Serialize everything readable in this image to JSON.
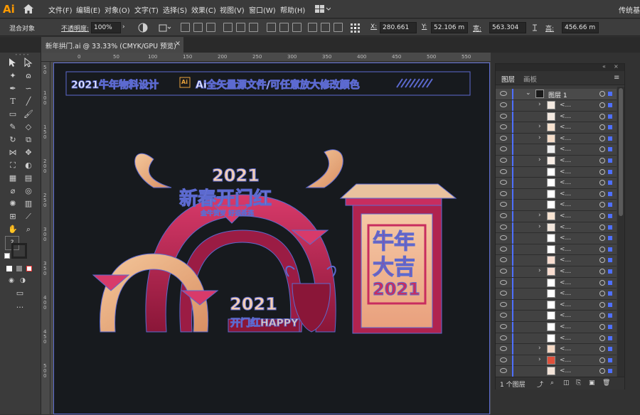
{
  "app": {
    "logo": "Ai",
    "workspace": "传统基"
  },
  "menu": [
    "文件(F)",
    "编辑(E)",
    "对象(O)",
    "文字(T)",
    "选择(S)",
    "效果(C)",
    "视图(V)",
    "窗口(W)",
    "帮助(H)"
  ],
  "control": {
    "object_type": "混合对象",
    "opacity_label": "不透明度:",
    "opacity_value": "100%",
    "x_label": "X:",
    "x_value": "280.661",
    "y_label": "Y:",
    "y_value": "52.106 m",
    "w_label": "宽:",
    "w_value": "563.304",
    "h_label": "高:",
    "h_value": "456.66 m"
  },
  "document_tab": {
    "title": "新年拱门.ai @ 33.33% (CMYK/GPU 预览)",
    "close": "×"
  },
  "rulers": {
    "top": [
      "0",
      "50",
      "100",
      "150",
      "200",
      "250",
      "300",
      "350",
      "400",
      "450",
      "500",
      "550"
    ],
    "left": [
      "5",
      "0",
      "1",
      "0",
      "0",
      "1",
      "5",
      "0",
      "2",
      "0",
      "0",
      "2",
      "5",
      "0",
      "3",
      "0",
      "0",
      "3",
      "5",
      "0",
      "4",
      "0",
      "0",
      "4",
      "5",
      "0",
      "5",
      "0",
      "0"
    ]
  },
  "artwork": {
    "banner_left": "2021牛年物料设计",
    "banner_ai": "Ai",
    "banner_right": "Ai全矢量源文件/可任意放大修改颜色",
    "arch_year": "2021",
    "arch_title": "新春开门红",
    "arch_sub": "金牛贺岁 好运连连",
    "small_year": "2021",
    "small_title": "开门红HAPPY",
    "gate_line1": "牛年",
    "gate_line2": "大吉",
    "gate_year": "2021"
  },
  "layers_panel": {
    "tab_layers": "图层",
    "tab_artboards": "画板",
    "top_layer_name": "图层 1",
    "sublayer_name": "<...",
    "footer_count": "1 个图层",
    "colors": {
      "selection": "#4e6fff"
    }
  }
}
